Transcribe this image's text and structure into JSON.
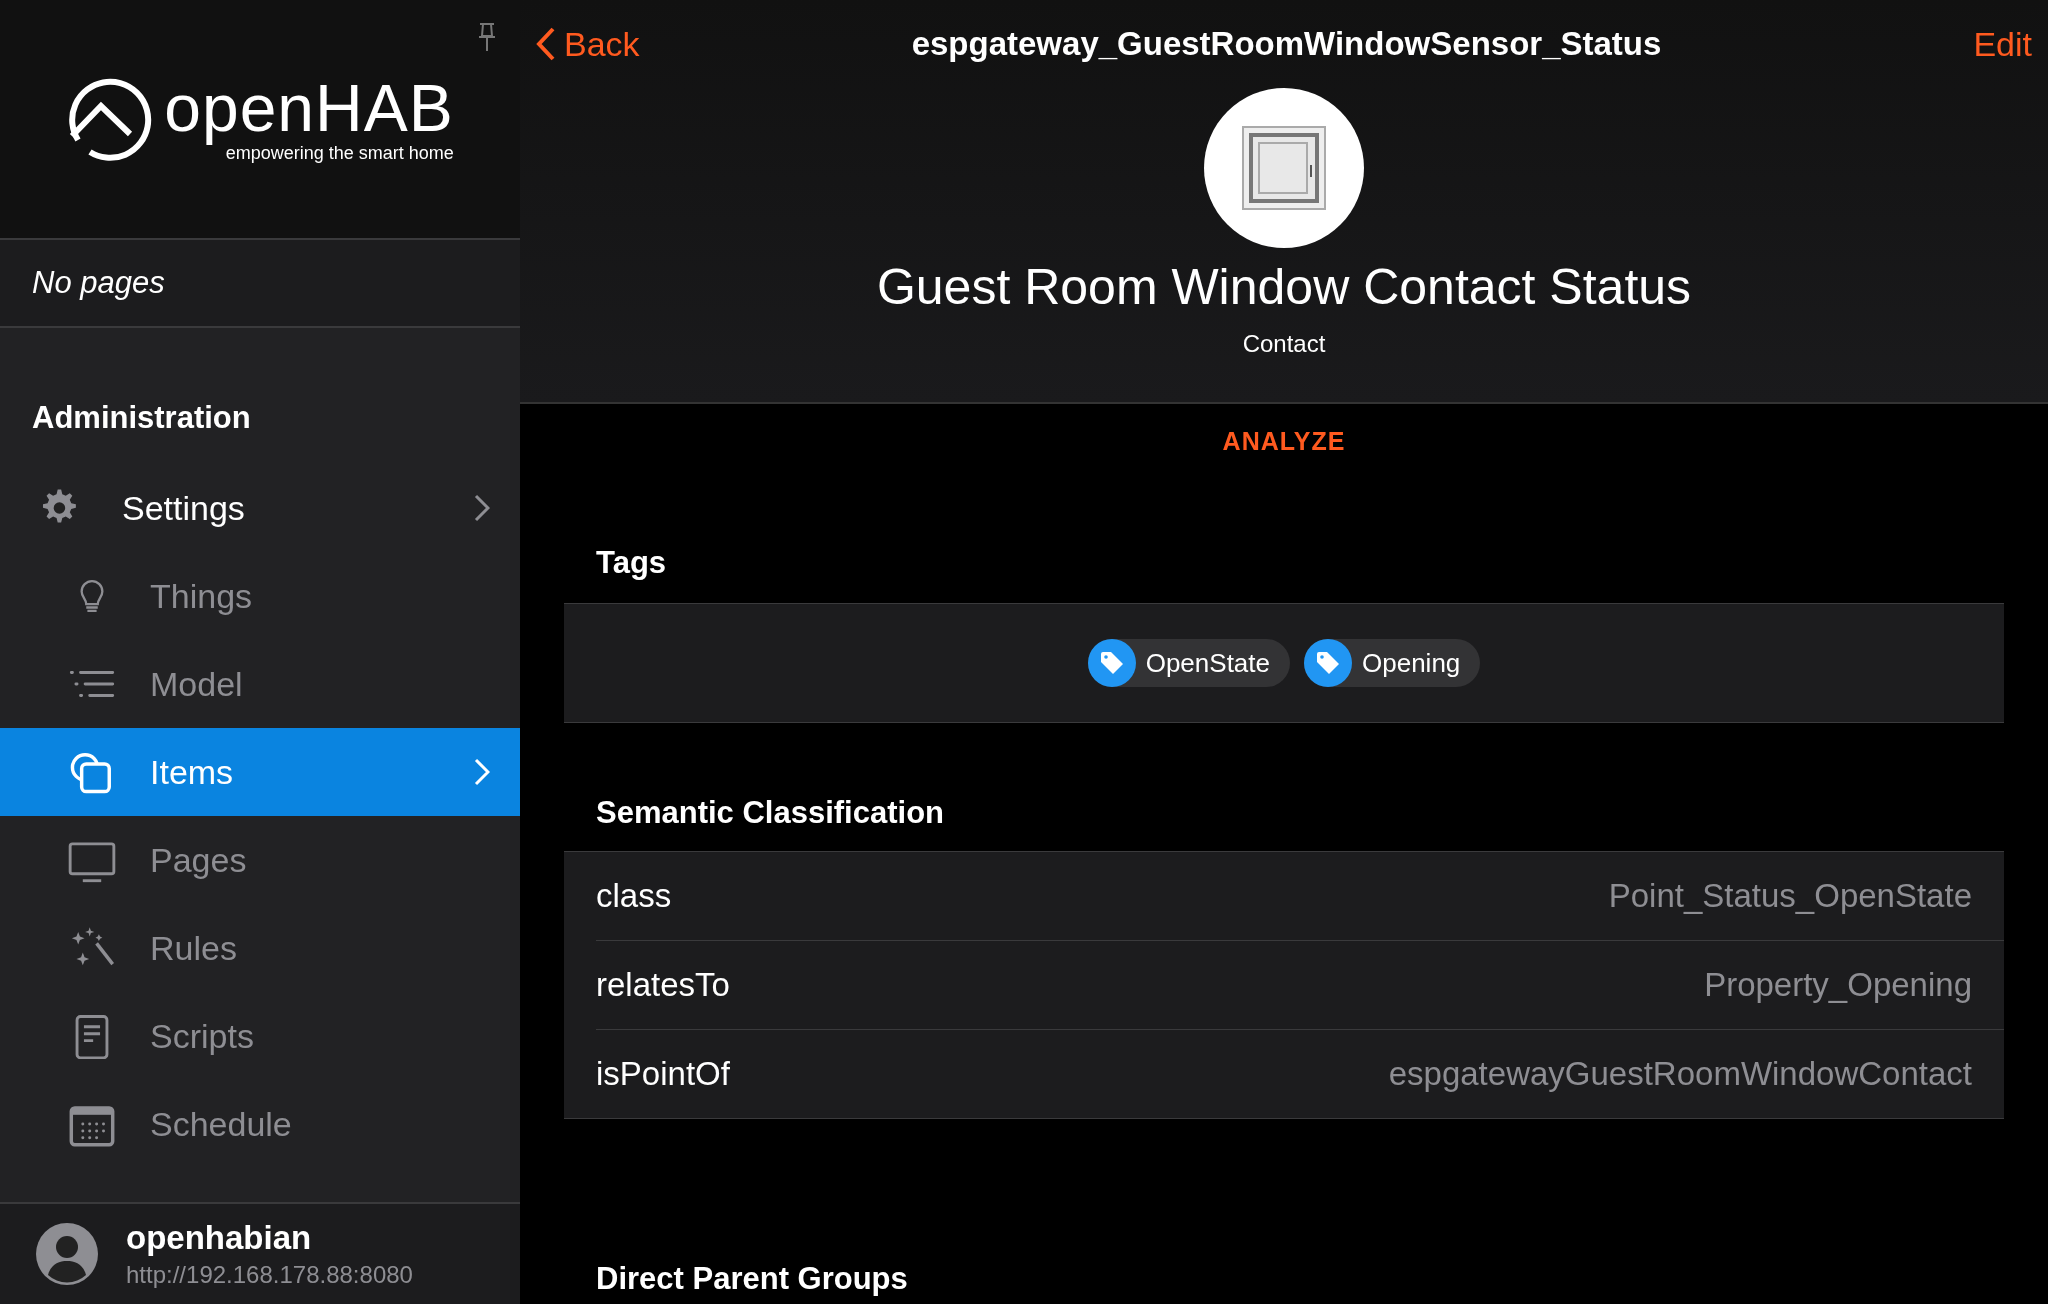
{
  "sidebar": {
    "logo": {
      "name": "openHAB",
      "tagline": "empowering the smart home"
    },
    "no_pages": "No pages",
    "section_title": "Administration",
    "items": [
      {
        "label": "Settings",
        "kind": "section",
        "selected": false
      },
      {
        "label": "Things",
        "kind": "item",
        "selected": false
      },
      {
        "label": "Model",
        "kind": "item",
        "selected": false
      },
      {
        "label": "Items",
        "kind": "item",
        "selected": true
      },
      {
        "label": "Pages",
        "kind": "item",
        "selected": false
      },
      {
        "label": "Rules",
        "kind": "item",
        "selected": false
      },
      {
        "label": "Scripts",
        "kind": "item",
        "selected": false
      },
      {
        "label": "Schedule",
        "kind": "item",
        "selected": false
      }
    ],
    "user": {
      "name": "openhabian",
      "url": "http://192.168.178.88:8080"
    }
  },
  "navbar": {
    "back": "Back",
    "title": "espgateway_GuestRoomWindowSensor_Status",
    "edit": "Edit"
  },
  "header": {
    "title": "Guest Room Window Contact Status",
    "type": "Contact"
  },
  "analyze": "ANALYZE",
  "tags": {
    "title": "Tags",
    "items": [
      "OpenState",
      "Opening"
    ]
  },
  "semantic": {
    "title": "Semantic Classification",
    "rows": [
      {
        "key": "class",
        "value": "Point_Status_OpenState"
      },
      {
        "key": "relatesTo",
        "value": "Property_Opening"
      },
      {
        "key": "isPointOf",
        "value": "espgatewayGuestRoomWindowContact"
      }
    ]
  },
  "parent_groups": {
    "title": "Direct Parent Groups"
  }
}
